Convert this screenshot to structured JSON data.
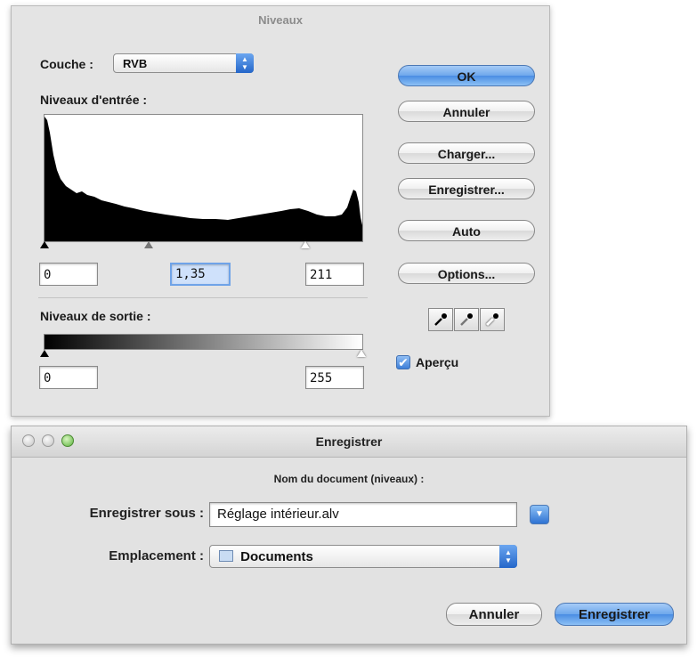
{
  "levels": {
    "title": "Niveaux",
    "channel_label": "Couche :",
    "channel_value": "RVB",
    "input_levels_label": "Niveaux d'entrée :",
    "input_black": "0",
    "input_gamma": "1,35",
    "input_white": "211",
    "output_levels_label": "Niveaux de sortie :",
    "output_black": "0",
    "output_white": "255",
    "buttons": {
      "ok": "OK",
      "cancel": "Annuler",
      "load": "Charger...",
      "save": "Enregistrer...",
      "auto": "Auto",
      "options": "Options..."
    },
    "preview_label": "Aperçu",
    "preview_checked": true
  },
  "save_dialog": {
    "title": "Enregistrer",
    "subtitle": "Nom du document (niveaux) :",
    "save_as_label": "Enregistrer sous :",
    "save_as_value": "Réglage intérieur.alv",
    "location_label": "Emplacement :",
    "location_value": "Documents",
    "buttons": {
      "cancel": "Annuler",
      "save": "Enregistrer"
    }
  }
}
